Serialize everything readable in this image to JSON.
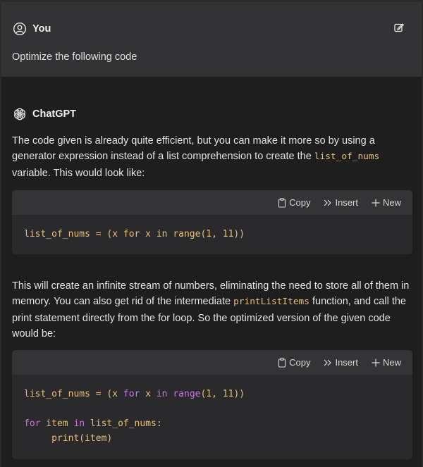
{
  "user": {
    "author": "You",
    "message": "Optimize the following code"
  },
  "assistant": {
    "author": "ChatGPT",
    "p1": {
      "before": "The code given is already quite efficient, but you can make it more so by using a generator expression instead of a list comprehension to create the ",
      "code": "list_of_nums",
      "after": " variable. This would look like:"
    },
    "p2": {
      "before": "This will create an infinite stream of numbers, eliminating the need to store all of them in memory. You can also get rid of the intermediate ",
      "code": "printListItems",
      "after": " function, and call the print statement directly from the for loop. So the optimized version of the given code would be:"
    }
  },
  "toolbar": {
    "copy_label": "Copy",
    "insert_label": "Insert",
    "new_label": "New"
  },
  "code1": {
    "line1": "list_of_nums = (x for x in range(1, 11))"
  },
  "code2": {
    "line1_pre": "list_of_nums = (x ",
    "line1_for": "for",
    "line1_mid": " x ",
    "line1_in": "in",
    "line1_sp": " ",
    "line1_range": "range",
    "line1_post": "(1, 11))",
    "line2_for": "for",
    "line2_mid": " item ",
    "line2_in": "in",
    "line2_post": " list_of_nums:",
    "line3": "     print(item)"
  },
  "colors": {
    "background": "#1f1f1f",
    "user_bg": "#333335",
    "code_bg": "#2a2a2c",
    "code_text": "#e5c07b",
    "keyword": "#c678dd"
  }
}
